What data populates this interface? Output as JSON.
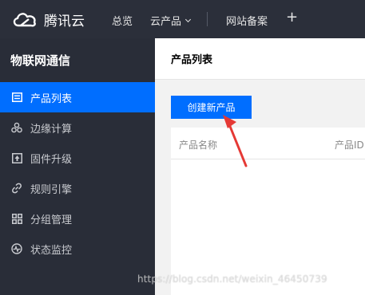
{
  "topbar": {
    "brand": "腾讯云",
    "nav": {
      "overview": "总览",
      "products": "云产品",
      "icp": "网站备案",
      "plus": "+"
    }
  },
  "sidebar": {
    "title": "物联网通信",
    "items": [
      {
        "label": "产品列表",
        "icon": "list-icon",
        "active": true
      },
      {
        "label": "边缘计算",
        "icon": "edge-compute-icon",
        "active": false
      },
      {
        "label": "固件升级",
        "icon": "upgrade-icon",
        "active": false
      },
      {
        "label": "规则引擎",
        "icon": "link-icon",
        "active": false
      },
      {
        "label": "分组管理",
        "icon": "group-icon",
        "active": false
      },
      {
        "label": "状态监控",
        "icon": "monitor-icon",
        "active": false
      }
    ]
  },
  "main": {
    "title": "产品列表",
    "create_button": "创建新产品",
    "table": {
      "columns": [
        "产品名称",
        "产品ID"
      ]
    }
  },
  "watermark": "https://blog.csdn.net/weixin_46450739",
  "colors": {
    "topbar_bg": "#2b2f3a",
    "sidebar_bg": "#292d38",
    "accent": "#006eff",
    "arrow": "#e53935"
  }
}
